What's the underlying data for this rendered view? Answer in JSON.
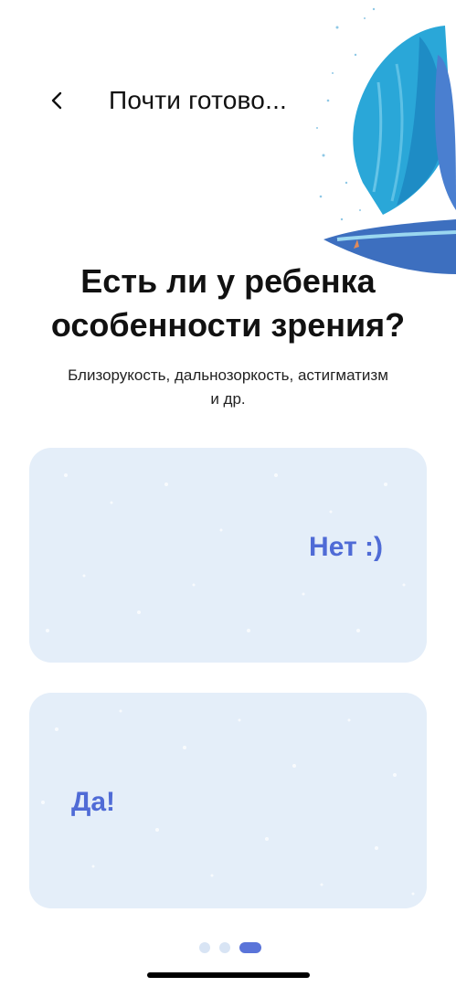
{
  "header": {
    "back_icon": "chevron-left-icon",
    "title": "Почти готово..."
  },
  "question": {
    "line1": "Есть ли у ребенка",
    "line2": "особенности зрения?",
    "subtitle_line1": "Близорукость, дальнозоркость, астигматизм",
    "subtitle_line2": "и др."
  },
  "options": [
    {
      "label": "Нет :)"
    },
    {
      "label": "Да!"
    }
  ],
  "pager": {
    "total": 3,
    "active": 3
  },
  "colors": {
    "accent": "#4f6bd6",
    "card_bg": "#e4eef9",
    "bird_blue": "#2aa7d8"
  }
}
